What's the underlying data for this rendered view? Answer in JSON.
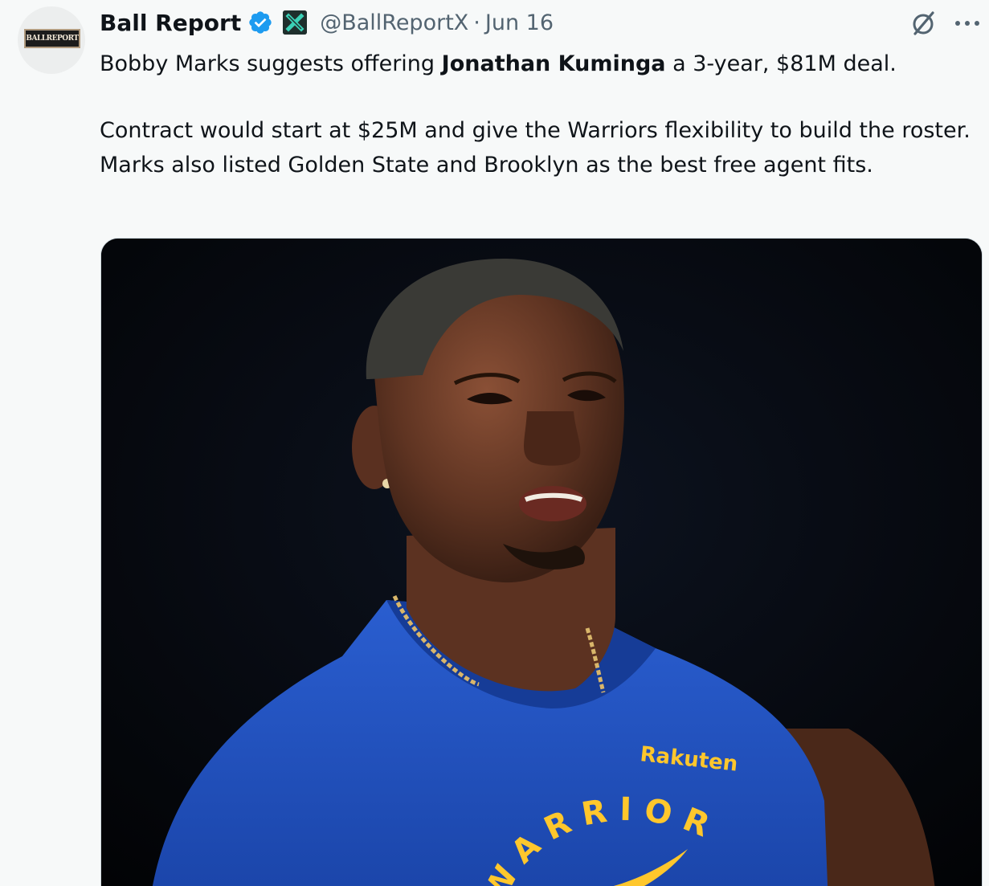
{
  "account": {
    "display_name": "Ball Report",
    "handle": "@BallReportX",
    "separator": "·",
    "date": "Jun 16",
    "avatar_text": "BALLREPORT"
  },
  "tweet": {
    "line1_before": "Bobby Marks suggests offering ",
    "line1_bold": "Jonathan Kuminga",
    "line1_after": " a 3-year, $81M deal.",
    "paragraph2": "Contract would start at $25M and give the Warriors flexibility to build the roster. Marks also listed Golden State and Brooklyn as the best free agent fits."
  },
  "media": {
    "shirt_sponsor": "Rakuten",
    "shirt_team": "WARRIORS",
    "shirt_partial": "TE"
  },
  "icons": {
    "verified": "verified-badge-icon",
    "affiliate": "x-affiliate-icon",
    "grok": "grok-icon",
    "more": "more-icon"
  },
  "colors": {
    "verified_blue": "#1d9bf0",
    "secondary_text": "#536471",
    "jersey_blue": "#1d4fb8",
    "jersey_yellow": "#ffc72c"
  }
}
